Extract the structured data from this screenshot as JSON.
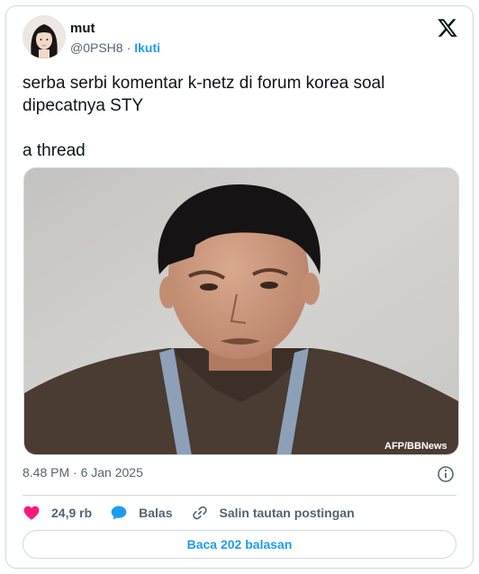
{
  "author": {
    "name": "mut",
    "handle": "@0PSH8",
    "separator": "·",
    "follow_label": "Ikuti"
  },
  "tweet": {
    "text": "serba serbi komentar k-netz di forum korea soal\ndipecatnya STY\n\na thread",
    "timestamp": "8.48 PM · 6 Jan 2025"
  },
  "media": {
    "watermark": "AFP/BBNews"
  },
  "actions": {
    "like_count": "24,9 rb",
    "reply_label": "Balas",
    "copy_link_label": "Salin tautan postingan"
  },
  "footer": {
    "read_replies_label": "Baca 202 balasan"
  },
  "icons": {
    "brand": "x-logo-icon",
    "like": "heart-icon",
    "reply": "speech-bubble-icon",
    "copy_link": "link-icon",
    "info": "info-icon"
  },
  "colors": {
    "accent": "#1d9bf0",
    "like": "#f91880",
    "secondary_text": "#536471",
    "border": "#cfd9de"
  }
}
